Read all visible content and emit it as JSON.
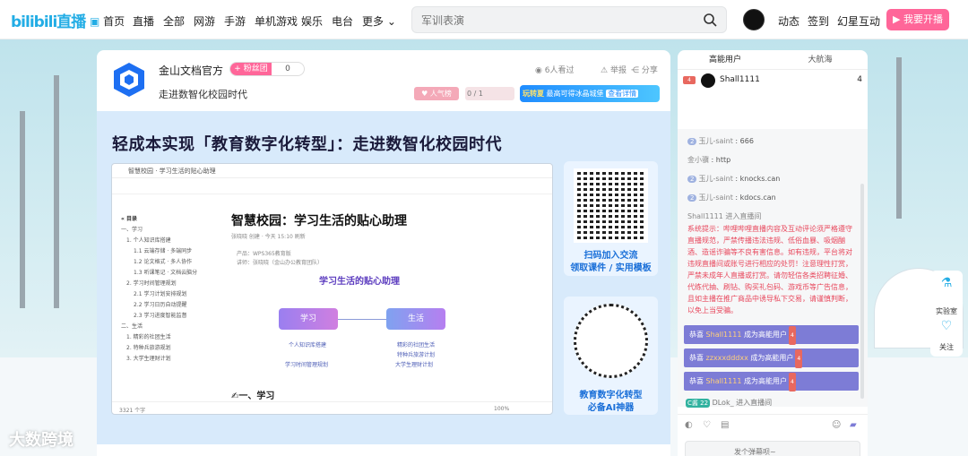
{
  "nav": {
    "logo": "bilibili直播",
    "home": "首页",
    "live": "直播",
    "all": "全部",
    "netgame": "网游",
    "mobile": "手游",
    "single": "单机游戏",
    "ent": "娱乐",
    "radio": "电台",
    "more": "更多",
    "search_placeholder": "军训表演",
    "dynamics": "动态",
    "checkin": "签到",
    "interact": "幻星互动",
    "start_live": "我要开播"
  },
  "room": {
    "owner": "金山文档官方",
    "follow_label": "+ 粉丝团",
    "follow_count": "0",
    "title": "走进数智化校园时代",
    "viewers": "6人看过",
    "report": "举报",
    "share": "分享",
    "popularity": "人气榜",
    "rank": "0 / 1",
    "ad_title": "玩转夏",
    "ad_text": "最高可得冰晶城堡",
    "ad_btn": "查看详情"
  },
  "stage": {
    "title": "轻成本实现「教育数字化转型」：走进数智化校园时代",
    "doc_tab": "智慧校园 · 学习生活的贴心助理",
    "doc_heading": "智慧校园：学习生活的贴心助理",
    "doc_author": "张晓晓 创建  ·  今天 15:10 刷新",
    "doc_product": "产品：WPS365教育版",
    "doc_lecturer": "讲师：张晓晓（金山办公教育团队）",
    "doc_sub": "学习生活的贴心助理",
    "mm_study": "学习",
    "mm_life": "生活",
    "mm_leaf1": "个人知识库搭建",
    "mm_leaf2": "学习时间管理规划",
    "mm_leaf3": "精彩的社团生活",
    "mm_leaf4": "特种兵旅游计划",
    "mm_leaf5": "大学生理财计划",
    "doc_h2": "一、学习",
    "doc_words": "3321 个字",
    "doc_zoom": "100%",
    "toc_title": "目录",
    "toc": [
      "一、学习",
      "1. 个人知识库搭建",
      "1.1 云端存储 · 多端同步",
      "1.2 论文格式 · 多人协作",
      "1.3 听课笔记 · 文档云脑分",
      "2. 学习时间管理规划",
      "2.1 学习计划安排规划",
      "2.2 学习日历自动提醒",
      "2.3 学习进度智能监督",
      "二、生活",
      "1. 精彩的社团生活",
      "2. 特种兵旅游规划",
      "3. 大学生理财计划"
    ],
    "qr1_line1": "扫码加入交流",
    "qr1_line2": "领取课件 / 实用模板",
    "qr2_line1": "教育数字化转型",
    "qr2_line2": "必备AI神器"
  },
  "panel": {
    "tab_high": "高能用户",
    "tab_captain": "大航海",
    "top_user": "Shall1111",
    "top_user_count": "4",
    "top_user_lv": "4",
    "chats": [
      {
        "lv": "2",
        "user": "玉儿-saint",
        "msg": "666"
      },
      {
        "lv": "",
        "user": "金小骥",
        "msg": "http"
      },
      {
        "lv": "2",
        "user": "玉儿-saint",
        "msg": "knocks.can"
      },
      {
        "lv": "2",
        "user": "玉儿-saint",
        "msg": "kdocs.can"
      }
    ],
    "enter_msg": "Shall1111 进入直播间",
    "system_notice": "系统提示：哔哩哔哩直播内容及互动评论须严格遵守直播规范，严禁传播违法违规、低俗血暴、吸烟酗酒、造谣诈骗等不良有害信息。如有违规，平台将对违规直播间或账号进行相应的处罚！注意理性打赏，严禁未成年人直播或打赏。请勿轻信各类招聘征婚、代练代抽、刷钻、购买礼包码、游戏币等广告信息，且如主播在推广商品中诱导私下交易，请谨慎判断，以免上当受骗。",
    "welcome_prefix": "恭喜",
    "welcome_suffix": "成为高能用户",
    "welcome_names": [
      "Shall1111",
      "zzxxxdddxx",
      "Shall1111"
    ],
    "welcome_icon": "4",
    "last_enter_badge": "C酱 22",
    "last_enter": "DLok_ 进入直播间",
    "dm_placeholder": "发个弹幕呗~",
    "lab": "实验室",
    "follow": "关注"
  },
  "watermark": "大数跨境",
  "colors": {
    "accent": "#ff6699",
    "brand": "#23ade5",
    "welcome_bar": "#7d7cd6",
    "notice": "#e8475c"
  }
}
